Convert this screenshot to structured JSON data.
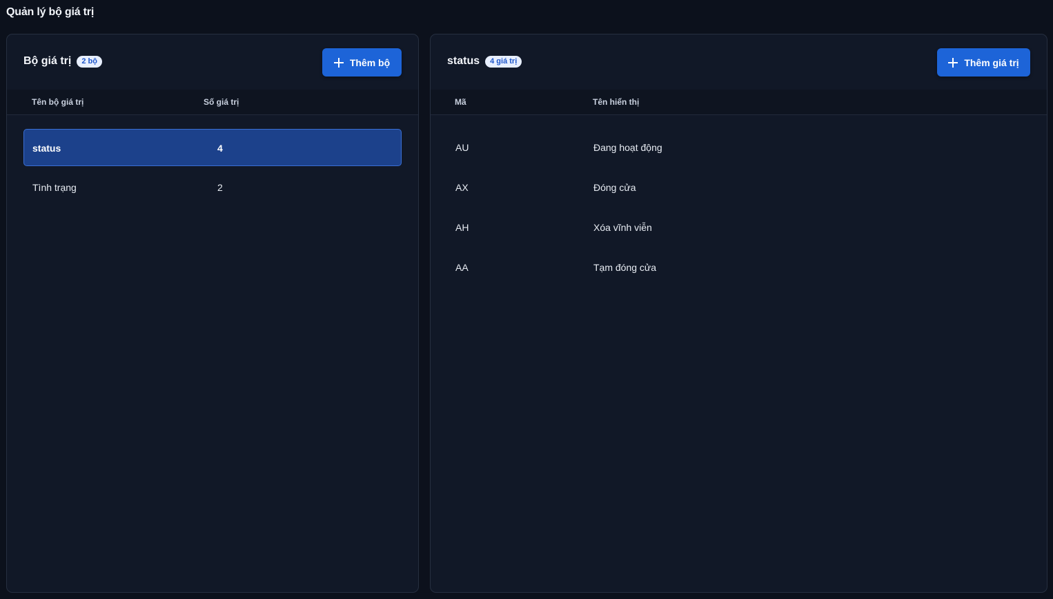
{
  "page": {
    "title": "Quản lý bộ giá trị"
  },
  "sets_panel": {
    "title": "Bộ giá trị",
    "badge": "2 bộ",
    "add_button": "Thêm bộ",
    "columns": {
      "name": "Tên bộ giá trị",
      "count": "Số giá trị"
    },
    "rows": [
      {
        "name": "status",
        "count": "4",
        "selected": true
      },
      {
        "name": "Tình trạng",
        "count": "2",
        "selected": false
      }
    ]
  },
  "values_panel": {
    "title": "status",
    "badge": "4 giá trị",
    "add_button": "Thêm giá trị",
    "columns": {
      "code": "Mã",
      "display_name": "Tên hiển thị"
    },
    "rows": [
      {
        "code": "AU",
        "display_name": "Đang hoạt động"
      },
      {
        "code": "AX",
        "display_name": "Đóng cửa"
      },
      {
        "code": "AH",
        "display_name": "Xóa vĩnh viễn"
      },
      {
        "code": "AA",
        "display_name": "Tạm đóng cửa"
      }
    ]
  },
  "colors": {
    "background": "#0c111c",
    "panel": "#111827",
    "accent": "#1d64d8",
    "selected_row": "#1c418b"
  },
  "icons": {
    "add": "plus-icon"
  }
}
